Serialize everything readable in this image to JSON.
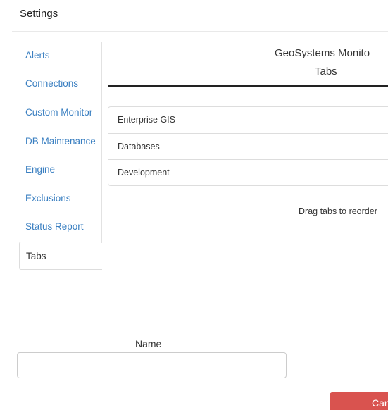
{
  "header": {
    "title": "Settings"
  },
  "sidebar": {
    "items": [
      {
        "label": "Alerts",
        "active": false
      },
      {
        "label": "Connections",
        "active": false
      },
      {
        "label": "Custom Monitor",
        "active": false
      },
      {
        "label": "DB Maintenance",
        "active": false
      },
      {
        "label": "Engine",
        "active": false
      },
      {
        "label": "Exclusions",
        "active": false
      },
      {
        "label": "Status Report",
        "active": false
      },
      {
        "label": "Tabs",
        "active": true
      }
    ]
  },
  "panel": {
    "title": "GeoSystems Monito",
    "subtitle": "Tabs",
    "tabs": [
      "Enterprise GIS",
      "Databases",
      "Development"
    ],
    "hint": "Drag tabs to reorder"
  },
  "form": {
    "name_label": "Name",
    "name_value": "",
    "name_placeholder": ""
  },
  "actions": {
    "cancel_label": "Can"
  },
  "colors": {
    "link": "#3a7fc1",
    "danger": "#d9534f",
    "border": "#dddddd"
  }
}
